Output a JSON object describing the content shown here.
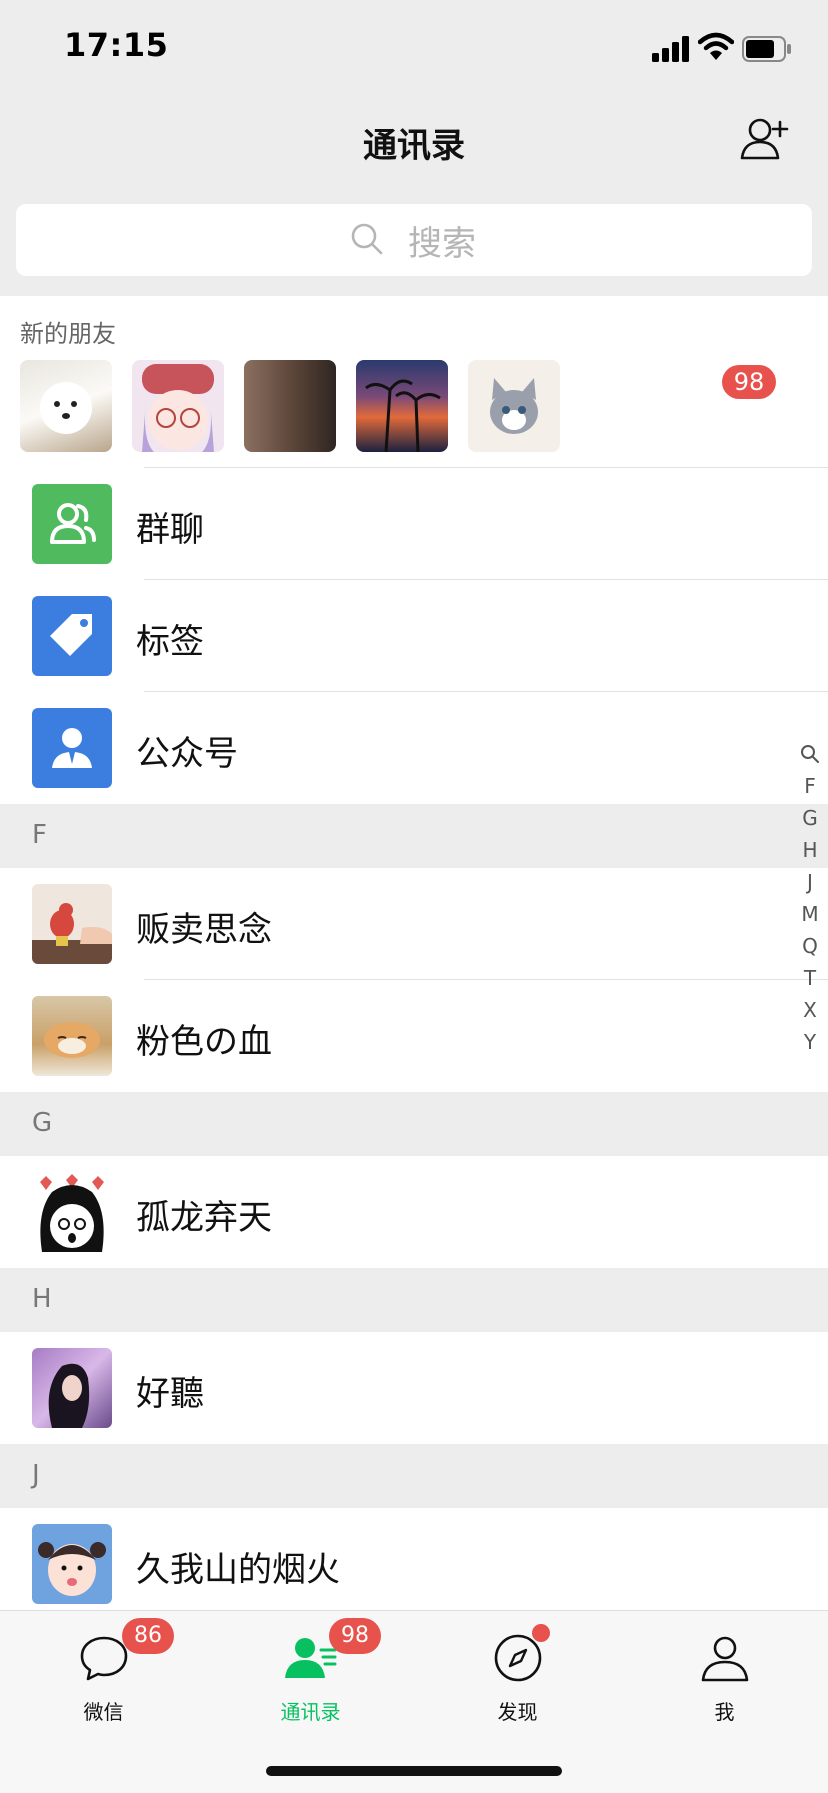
{
  "status": {
    "time": "17:15"
  },
  "header": {
    "title": "通讯录"
  },
  "search": {
    "placeholder": "搜索"
  },
  "new_friends": {
    "label": "新的朋友",
    "badge": "98"
  },
  "menu": [
    {
      "label": "群聊",
      "icon": "group-chat-icon",
      "color": "#4fbb5e"
    },
    {
      "label": "标签",
      "icon": "tag-icon",
      "color": "#3c7ee0"
    },
    {
      "label": "公众号",
      "icon": "official-account-icon",
      "color": "#3c7ee0"
    }
  ],
  "sections": [
    {
      "letter": "F",
      "contacts": [
        "贩卖思念",
        "粉色の血"
      ]
    },
    {
      "letter": "G",
      "contacts": [
        "孤龙弃天"
      ]
    },
    {
      "letter": "H",
      "contacts": [
        "好聽"
      ]
    },
    {
      "letter": "J",
      "contacts": [
        "久我山的烟火"
      ]
    }
  ],
  "index": [
    "F",
    "G",
    "H",
    "J",
    "M",
    "Q",
    "T",
    "X",
    "Y"
  ],
  "tabs": [
    {
      "label": "微信",
      "badge": "86",
      "icon": "chat-bubble-icon"
    },
    {
      "label": "通讯录",
      "badge": "98",
      "icon": "contacts-icon",
      "active": true
    },
    {
      "label": "发现",
      "badge": "",
      "icon": "compass-icon"
    },
    {
      "label": "我",
      "badge": "",
      "icon": "profile-icon"
    }
  ],
  "colors": {
    "accent": "#07c160",
    "badge": "#e8524d"
  }
}
